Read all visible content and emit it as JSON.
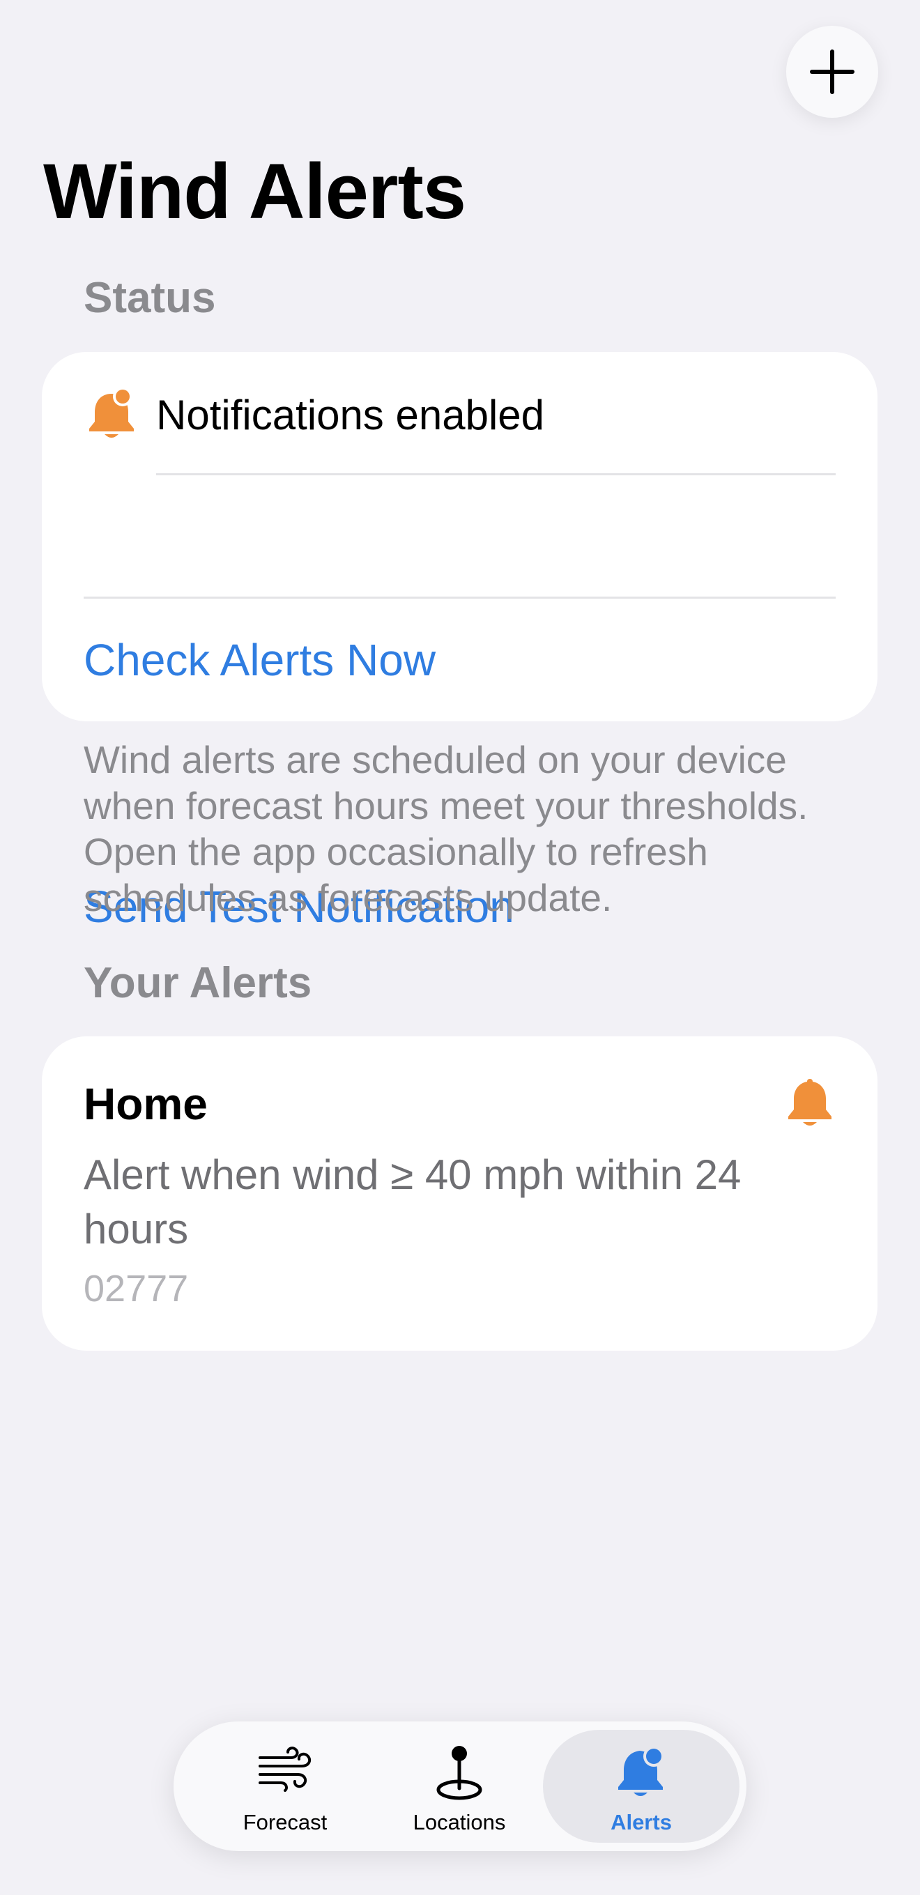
{
  "header": {
    "add_button_icon": "plus-icon",
    "title": "Wind Alerts"
  },
  "status": {
    "header": "Status",
    "notifications_icon": "bell-badge-icon",
    "notifications_label": "Notifications enabled",
    "check_alerts_label": "Check Alerts Now",
    "send_test_label": "Send Test Notification",
    "footer": "Wind alerts are scheduled on your device when forecast hours meet your thresholds. Open the app occasionally to refresh schedules as forecasts update."
  },
  "alerts": {
    "header": "Your Alerts",
    "items": [
      {
        "name": "Home",
        "description": "Alert when wind ≥ 40 mph within 24 hours",
        "zip": "02777",
        "icon": "bell-icon"
      }
    ]
  },
  "tabbar": {
    "tabs": [
      {
        "label": "Forecast",
        "icon": "wind-icon",
        "selected": false
      },
      {
        "label": "Locations",
        "icon": "location-pin-icon",
        "selected": false
      },
      {
        "label": "Alerts",
        "icon": "bell-badge-icon",
        "selected": true
      }
    ]
  },
  "colors": {
    "background": "#F2F1F6",
    "accent_blue": "#2F7DE1",
    "alert_orange": "#F0903A",
    "secondary_text": "#8A8A8E"
  }
}
